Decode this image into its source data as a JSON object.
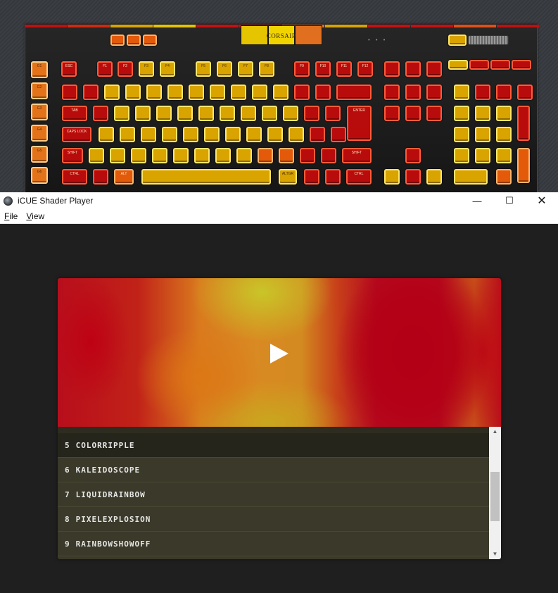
{
  "keyboard": {
    "brand": "CORSAIR",
    "gkeys": [
      "G1",
      "G2",
      "G3",
      "G4",
      "G5",
      "G6"
    ],
    "fn_row": [
      "ESC",
      "F1",
      "F2",
      "F3",
      "F4",
      "F5",
      "F6",
      "F7",
      "F8",
      "F9",
      "F10",
      "F11",
      "F12"
    ],
    "special": {
      "tab": "TAB",
      "caps": "CAPS LOCK",
      "shift_l": "SHIFT",
      "shift_r": "SHIFT",
      "ctrl_l": "CTRL",
      "ctrl_r": "CTRL",
      "alt": "ALT",
      "altgr": "ALTGR",
      "enter": "ENTER"
    },
    "colors": {
      "red": "#c81010",
      "yellow": "#d9a300",
      "orange": "#e35a0a"
    }
  },
  "window": {
    "title": "iCUE Shader Player",
    "minimize": "—",
    "maximize": "☐",
    "close": "✕"
  },
  "menu": {
    "file": {
      "accel": "F",
      "rest": "ile"
    },
    "view": {
      "accel": "V",
      "rest": "iew"
    }
  },
  "player": {
    "play_icon": "play-icon",
    "preview_colors": [
      "#b40a1f",
      "#d98a22",
      "#c8c828"
    ]
  },
  "shaders": [
    {
      "num": "5",
      "name": "COLORRIPPLE",
      "selected": true
    },
    {
      "num": "6",
      "name": "KALEIDOSCOPE",
      "selected": false
    },
    {
      "num": "7",
      "name": "LIQUIDRAINBOW",
      "selected": false
    },
    {
      "num": "8",
      "name": "PIXELEXPLOSION",
      "selected": false
    },
    {
      "num": "9",
      "name": "RAINBOWSHOWOFF",
      "selected": false
    }
  ],
  "scroll": {
    "up_icon": "▲",
    "down_icon": "▼"
  }
}
